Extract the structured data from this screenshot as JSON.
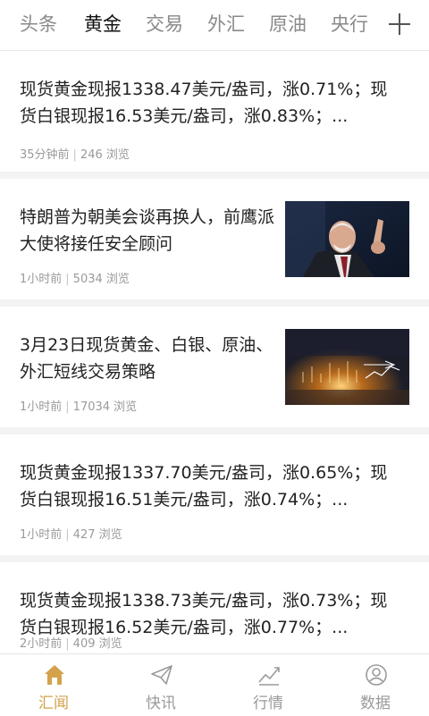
{
  "tabs": [
    "头条",
    "黄金",
    "交易",
    "外汇",
    "原油",
    "央行"
  ],
  "active_tab": "黄金",
  "feed": [
    {
      "title": "现货黄金现报1338.47美元/盎司，涨0.71%；现货白银现报16.53美元/盎司，涨0.83%；...",
      "time": "35分钟前",
      "views": "246 浏览"
    },
    {
      "title": "特朗普为朝美会谈再换人，前鹰派大使将接任安全顾问",
      "time": "1小时前",
      "views": "5034 浏览",
      "thumb": "portrait-photo"
    },
    {
      "title": "3月23日现货黄金、白银、原油、外汇短线交易策略",
      "time": "1小时前",
      "views": "17034 浏览",
      "thumb": "trading-chart-photo"
    },
    {
      "title": "现货黄金现报1337.70美元/盎司，涨0.65%；现货白银现报16.51美元/盎司，涨0.74%；...",
      "time": "1小时前",
      "views": "427 浏览"
    },
    {
      "title": "现货黄金现报1338.73美元/盎司，涨0.73%；现货白银现报16.52美元/盎司，涨0.77%；...",
      "time": "2小时前",
      "views": "409 浏览"
    }
  ],
  "bottom_nav": [
    {
      "label": "汇闻",
      "icon": "home-icon",
      "active": true
    },
    {
      "label": "快讯",
      "icon": "paper-plane-icon",
      "active": false
    },
    {
      "label": "行情",
      "icon": "chart-icon",
      "active": false
    },
    {
      "label": "数据",
      "icon": "user-icon",
      "active": false
    }
  ],
  "colors": {
    "accent": "#d4a24c",
    "meta": "#9a9a9a",
    "divider": "#f3f3f3"
  }
}
